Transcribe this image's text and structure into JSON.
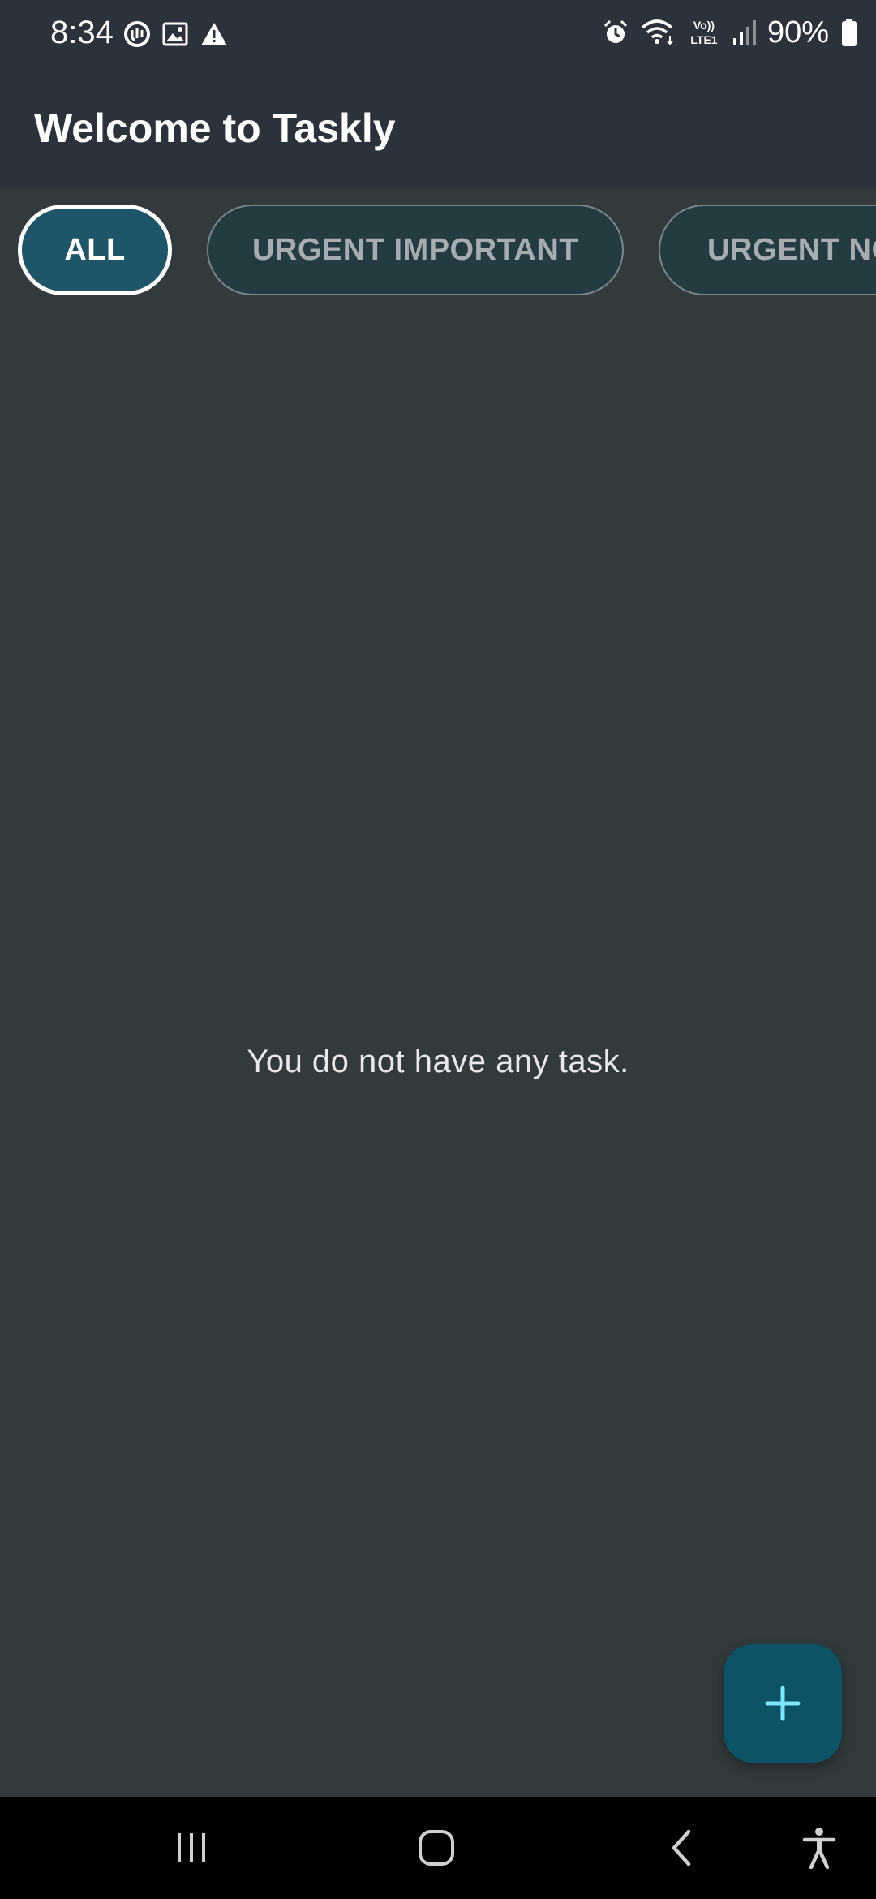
{
  "status_bar": {
    "time": "8:34",
    "battery_percent": "90%",
    "left_icons": [
      "sync-icon",
      "image-icon",
      "warning-icon"
    ],
    "right_icons": [
      "alarm-icon",
      "wifi-icon",
      "volte-icon",
      "signal-icon",
      "battery-icon"
    ],
    "volte_label_top": "Vo))",
    "volte_label_bottom": "LTE1"
  },
  "app_bar": {
    "title": "Welcome to Taskly"
  },
  "filters": {
    "selected": "ALL",
    "items": [
      {
        "label": "ALL"
      },
      {
        "label": "URGENT IMPORTANT"
      },
      {
        "label": "URGENT NO"
      }
    ]
  },
  "main": {
    "empty_message": "You do not have any task."
  },
  "fab": {
    "icon": "plus-icon"
  },
  "nav_bar": {
    "buttons": [
      "recents-icon",
      "home-icon",
      "back-icon",
      "accessibility-icon"
    ]
  },
  "colors": {
    "app_bar_bg": "#2c323c",
    "screen_bg": "#323a3d",
    "chip_active_bg": "#1f5568",
    "chip_inactive_bg": "#253b42",
    "fab_bg": "#0c5366",
    "fab_icon": "#7fe6ff"
  }
}
